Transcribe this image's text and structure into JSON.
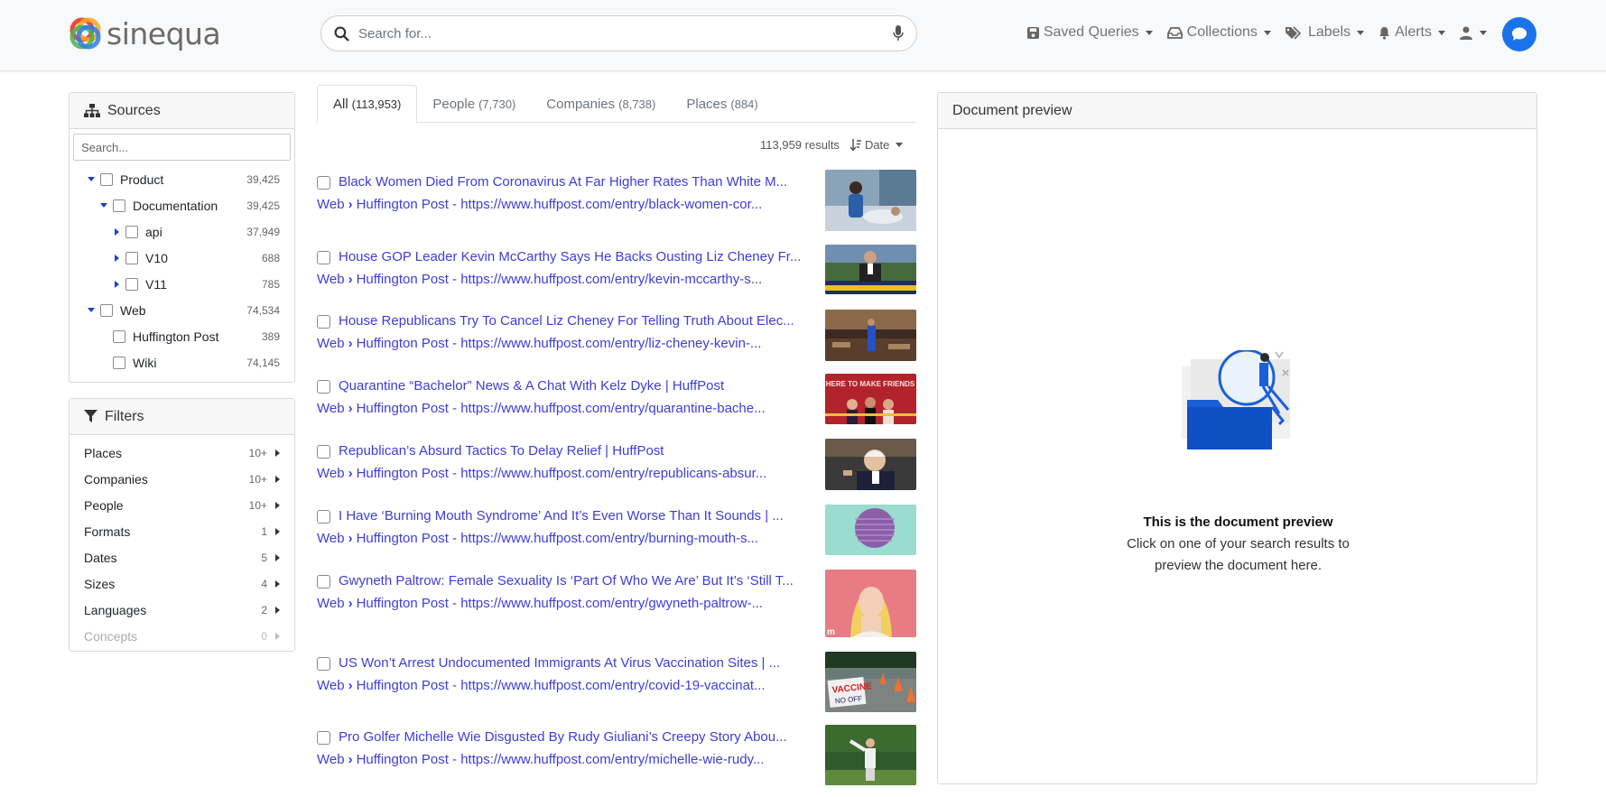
{
  "brand": {
    "name": "sinequa"
  },
  "search": {
    "placeholder": "Search for..."
  },
  "nav": {
    "saved_queries": "Saved Queries",
    "collections": "Collections",
    "labels": "Labels",
    "alerts": "Alerts"
  },
  "sources": {
    "title": "Sources",
    "search_placeholder": "Search...",
    "items": [
      {
        "label": "Product",
        "count": "39,425"
      },
      {
        "label": "Documentation",
        "count": "39,425"
      },
      {
        "label": "api",
        "count": "37,949"
      },
      {
        "label": "V10",
        "count": "688"
      },
      {
        "label": "V11",
        "count": "785"
      },
      {
        "label": "Web",
        "count": "74,534"
      },
      {
        "label": "Huffington Post",
        "count": "389"
      },
      {
        "label": "Wiki",
        "count": "74,145"
      }
    ]
  },
  "filters": {
    "title": "Filters",
    "items": [
      {
        "label": "Places",
        "count": "10+"
      },
      {
        "label": "Companies",
        "count": "10+"
      },
      {
        "label": "People",
        "count": "10+"
      },
      {
        "label": "Formats",
        "count": "1"
      },
      {
        "label": "Dates",
        "count": "5"
      },
      {
        "label": "Sizes",
        "count": "4"
      },
      {
        "label": "Languages",
        "count": "2"
      },
      {
        "label": "Concepts",
        "count": "0"
      }
    ]
  },
  "tabs": [
    {
      "label": "All",
      "count": "(113,953)"
    },
    {
      "label": "People",
      "count": "(7,730)"
    },
    {
      "label": "Companies",
      "count": "(8,738)"
    },
    {
      "label": "Places",
      "count": "(884)"
    }
  ],
  "results_meta": {
    "count": "113,959 results",
    "sort": "Date"
  },
  "results": [
    {
      "title": "Black Women Died From Coronavirus At Far Higher Rates Than White M...",
      "src1": "Web",
      "src2": "Huffington Post",
      "url": "https://www.huffpost.com/entry/black-women-cor..."
    },
    {
      "title": "House GOP Leader Kevin McCarthy Says He Backs Ousting Liz Cheney Fr...",
      "src1": "Web",
      "src2": "Huffington Post",
      "url": "https://www.huffpost.com/entry/kevin-mccarthy-s..."
    },
    {
      "title": "House Republicans Try To Cancel Liz Cheney For Telling Truth About Elec...",
      "src1": "Web",
      "src2": "Huffington Post",
      "url": "https://www.huffpost.com/entry/liz-cheney-kevin-..."
    },
    {
      "title": "Quarantine “Bachelor” News & A Chat With Kelz Dyke | HuffPost",
      "src1": "Web",
      "src2": "Huffington Post",
      "url": "https://www.huffpost.com/entry/quarantine-bache..."
    },
    {
      "title": "Republican’s Absurd Tactics To Delay Relief | HuffPost",
      "src1": "Web",
      "src2": "Huffington Post",
      "url": "https://www.huffpost.com/entry/republicans-absur..."
    },
    {
      "title": "I Have ‘Burning Mouth Syndrome’ And It’s Even Worse Than It Sounds | ...",
      "src1": "Web",
      "src2": "Huffington Post",
      "url": "https://www.huffpost.com/entry/burning-mouth-s..."
    },
    {
      "title": "Gwyneth Paltrow: Female Sexuality Is ‘Part Of Who We Are’ But It’s ‘Still T...",
      "src1": "Web",
      "src2": "Huffington Post",
      "url": "https://www.huffpost.com/entry/gwyneth-paltrow-..."
    },
    {
      "title": "US Won’t Arrest Undocumented Immigrants At Virus Vaccination Sites | ...",
      "src1": "Web",
      "src2": "Huffington Post",
      "url": "https://www.huffpost.com/entry/covid-19-vaccinat..."
    },
    {
      "title": "Pro Golfer Michelle Wie Disgusted By Rudy Giuliani’s Creepy Story Abou...",
      "src1": "Web",
      "src2": "Huffington Post",
      "url": "https://www.huffpost.com/entry/michelle-wie-rudy..."
    }
  ],
  "thumb_text": {
    "bachelor": "HERE TO MAKE FRIENDS",
    "vaccine": "VACCINE",
    "vaccine2": "NO OFF"
  },
  "preview": {
    "title": "Document preview",
    "heading": "This is the document preview",
    "body": "Click on one of your search results to preview the document here."
  },
  "colors": {
    "link": "#3d3dd8",
    "accent": "#1a73e8",
    "tree_caret": "#1a3fd0"
  }
}
